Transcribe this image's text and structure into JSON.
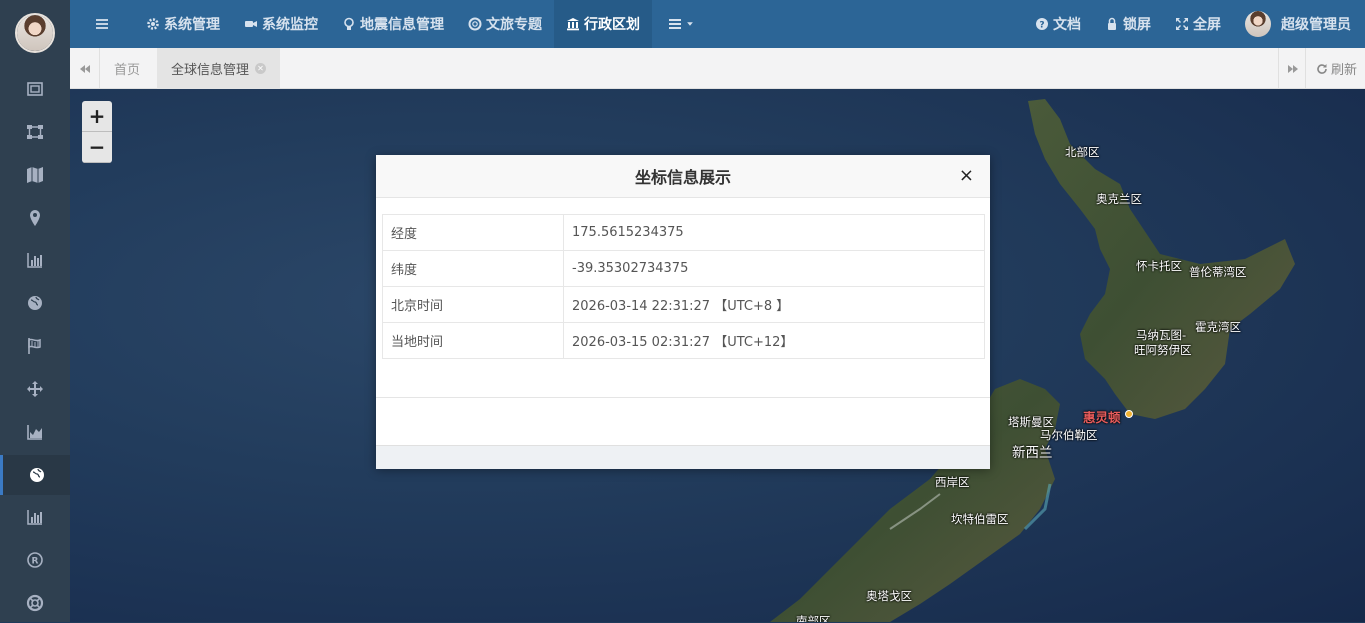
{
  "sidebar": {
    "items": [
      {
        "icon": "frame-icon"
      },
      {
        "icon": "network-icon"
      },
      {
        "icon": "map-icon"
      },
      {
        "icon": "map-pin-icon"
      },
      {
        "icon": "bar-chart-icon"
      },
      {
        "icon": "globe-icon"
      },
      {
        "icon": "flag-icon"
      },
      {
        "icon": "move-icon"
      },
      {
        "icon": "area-chart-icon"
      },
      {
        "icon": "globe-icon",
        "active": true
      },
      {
        "icon": "bar-chart-icon"
      },
      {
        "icon": "registered-icon"
      },
      {
        "icon": "life-ring-icon"
      }
    ]
  },
  "topnav": {
    "items": [
      {
        "label": "系统管理",
        "icon": "gear-icon"
      },
      {
        "label": "系统监控",
        "icon": "video-camera-icon"
      },
      {
        "label": "地震信息管理",
        "icon": "lightbulb-icon"
      },
      {
        "label": "文旅专题",
        "icon": "life-ring-icon"
      },
      {
        "label": "行政区划",
        "icon": "bank-icon",
        "active": true
      }
    ],
    "right": {
      "docs": "文档",
      "lock": "锁屏",
      "fullscreen": "全屏",
      "user": "超级管理员"
    }
  },
  "tabs": {
    "items": [
      "首页",
      "全球信息管理"
    ],
    "active": "全球信息管理",
    "refresh": "刷新"
  },
  "map": {
    "zoom_in": "+",
    "zoom_out": "−",
    "labels": [
      "北部区",
      "奥克兰区",
      "怀卡托区",
      "普伦蒂湾区",
      "马纳瓦图-",
      "旺阿努伊区",
      "霍克湾区",
      "惠灵顿",
      "塔斯曼区",
      "马尔伯勒区",
      "新西兰",
      "西岸区",
      "坎特伯雷区",
      "奥塔戈区",
      "南部区"
    ]
  },
  "modal": {
    "title": "坐标信息展示",
    "close": "×",
    "rows": [
      {
        "key": "经度",
        "value": "175.5615234375"
      },
      {
        "key": "纬度",
        "value": "-39.35302734375"
      },
      {
        "key": "北京时间",
        "value": "2026-03-14 22:31:27 【UTC+8 】"
      },
      {
        "key": "当地时间",
        "value": "2026-03-15 02:31:27 【UTC+12】"
      }
    ]
  },
  "colors": {
    "sidebar": "#2f4050",
    "topnav": "#2c6596",
    "accent": "#3b7ac4"
  }
}
